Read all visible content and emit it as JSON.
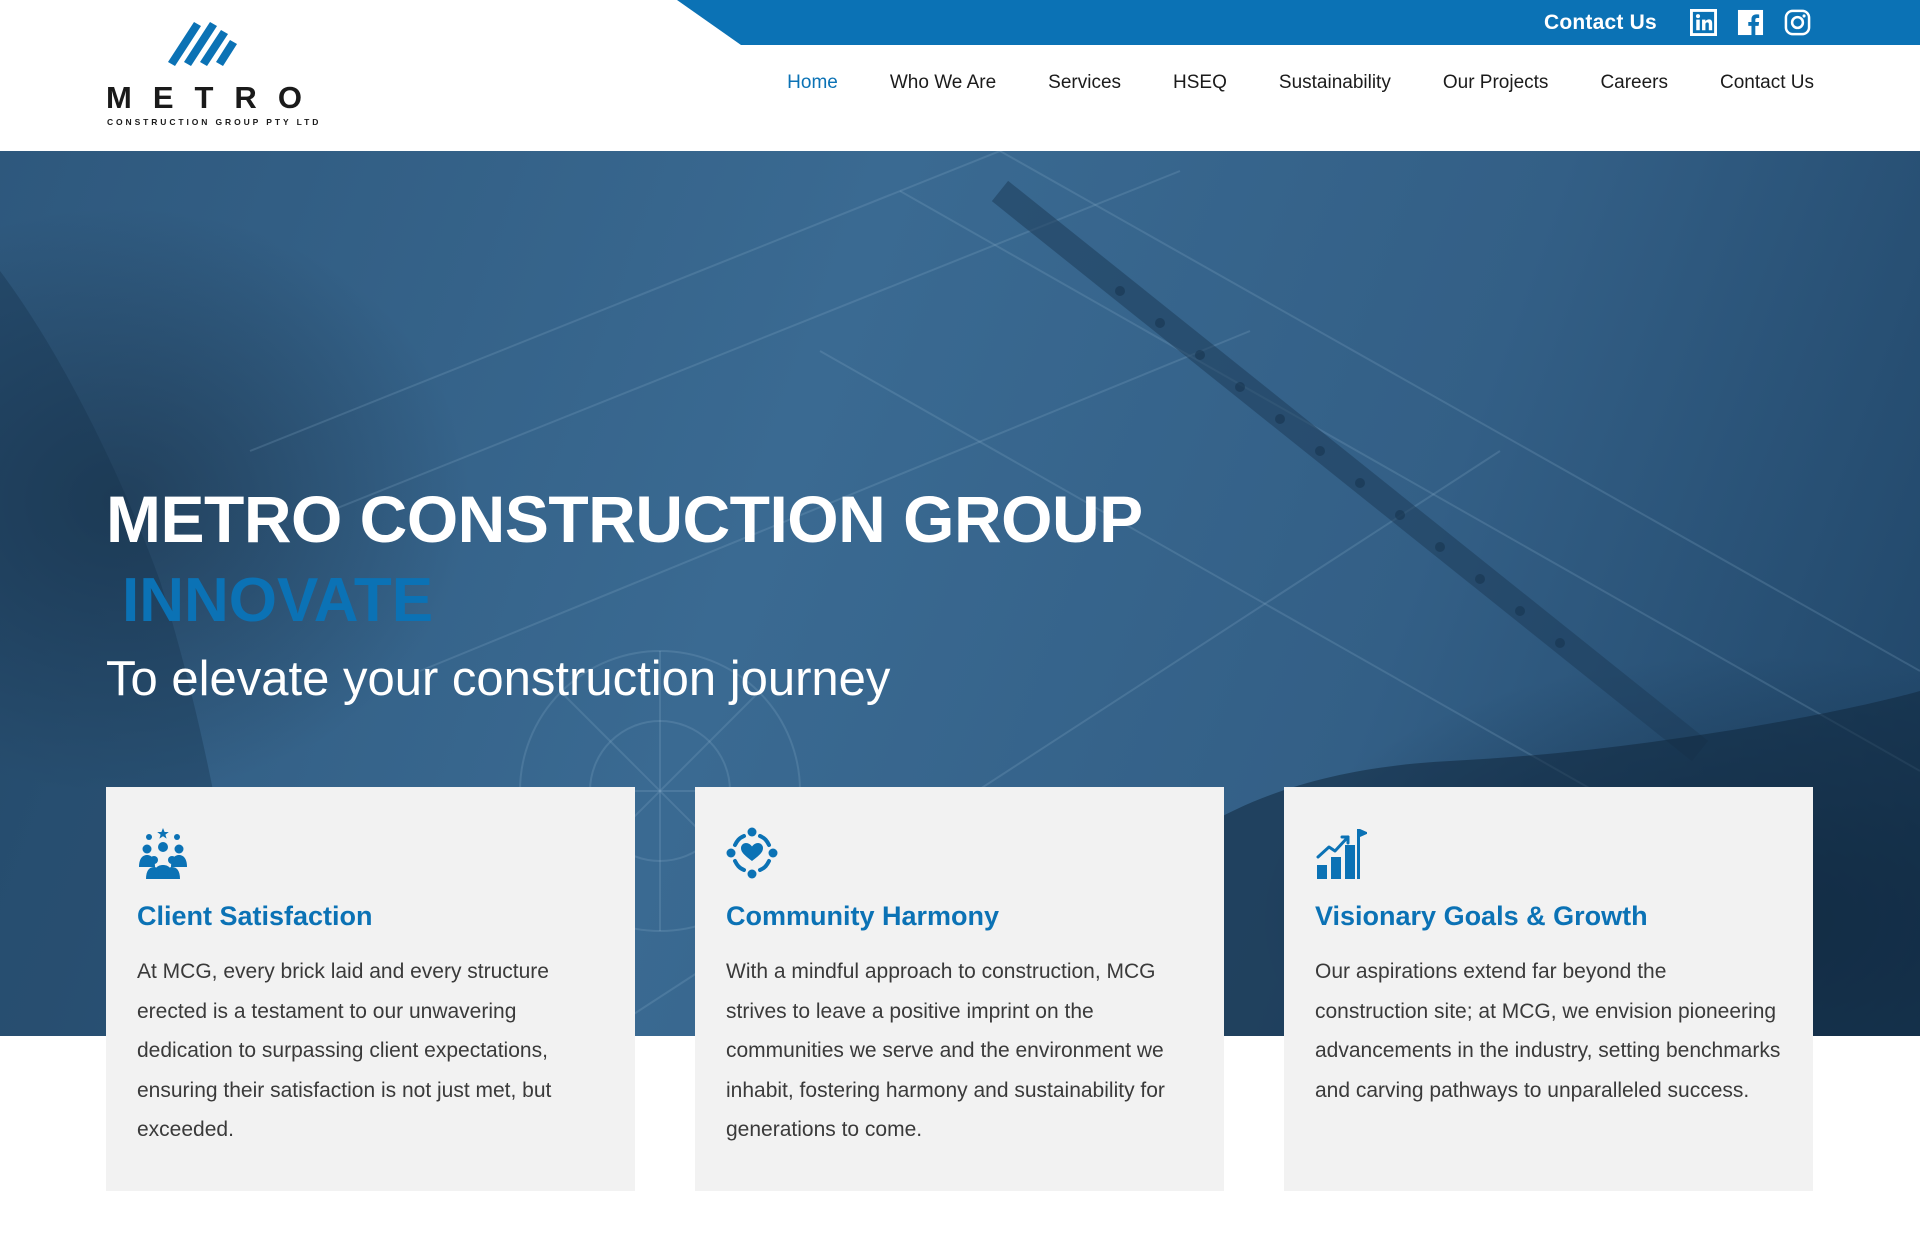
{
  "brand": {
    "name": "METRO",
    "subtitle": "CONSTRUCTION GROUP PTY LTD"
  },
  "topbar": {
    "contact_label": "Contact Us",
    "social": [
      "linkedin-icon",
      "facebook-icon",
      "instagram-icon"
    ]
  },
  "nav": {
    "items": [
      {
        "label": "Home",
        "active": true
      },
      {
        "label": "Who We Are"
      },
      {
        "label": "Services"
      },
      {
        "label": "HSEQ"
      },
      {
        "label": "Sustainability"
      },
      {
        "label": "Our Projects"
      },
      {
        "label": "Careers"
      },
      {
        "label": "Contact Us"
      }
    ]
  },
  "hero": {
    "title": "METRO CONSTRUCTION GROUP",
    "highlight": "INNOVATE",
    "tagline": "To elevate your construction journey"
  },
  "cards": [
    {
      "icon": "people-group-icon",
      "title": "Client Satisfaction",
      "body": "At MCG, every brick laid and every structure erected is a testament to our unwavering dedication to surpassing client expectations, ensuring their satisfaction is not just met, but exceeded."
    },
    {
      "icon": "community-heart-icon",
      "title": "Community Harmony",
      "body": "With a mindful approach to construction, MCG strives to leave a positive imprint on the communities we serve and the environment we inhabit, fostering harmony and sustainability for generations to come."
    },
    {
      "icon": "growth-chart-icon",
      "title": "Visionary Goals & Growth",
      "body": "Our aspirations extend far beyond the construction site; at MCG, we envision pioneering advancements in the industry, setting benchmarks and carving pathways to unparalleled success."
    }
  ],
  "colors": {
    "accent": "#0b72b5",
    "hero_overlay": "#2e587d",
    "card_bg": "#f2f2f2",
    "text_dark": "#1b1b1b"
  }
}
